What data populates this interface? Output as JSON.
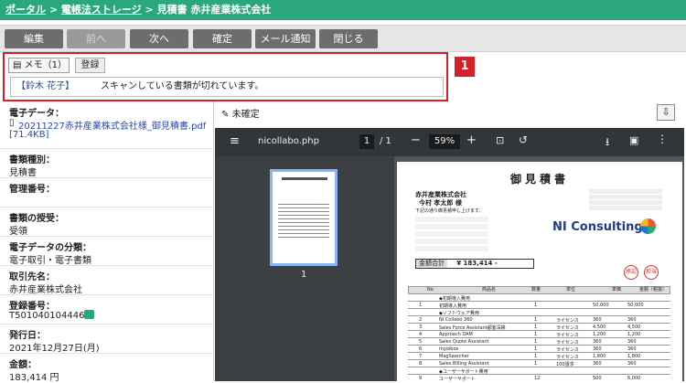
{
  "breadcrumb": {
    "portal": "ポータル",
    "sep1": " > ",
    "storage": "電帳法ストレージ",
    "sep2": " > ",
    "current": "見積書 赤井産業株式会社"
  },
  "toolbar": {
    "edit": "編集",
    "prev": "前へ",
    "next": "次へ",
    "confirm": "確定",
    "mail": "メール通知",
    "close": "閉じる"
  },
  "memo": {
    "tab_label": "メモ（1）",
    "register": "登録",
    "user": "【鈴木 花子】",
    "text": "スキャンしている書類が切れています。",
    "badge": "1"
  },
  "fields": [
    {
      "label": "電子データ：",
      "value": "20211227赤井産業株式会社様_御見積書.pdf",
      "extra": "[71.4KB]"
    },
    {
      "label": "書類種別：",
      "value": "見積書"
    },
    {
      "label": "管理番号：",
      "value": ""
    },
    {
      "label": "書類の授受：",
      "value": "受領"
    },
    {
      "label": "電子データの分類：",
      "value": "電子取引・電子書類"
    },
    {
      "label": "取引先名：",
      "value": "赤井産業株式会社"
    },
    {
      "label": "登録番号：",
      "value": "T5010401044466"
    },
    {
      "label": "発行日：",
      "value": "2021年12月27日(月)"
    },
    {
      "label": "金額：",
      "value": "183,414 円"
    }
  ],
  "viewer": {
    "status": "未確定",
    "file": "nicollabo.php",
    "page": "1",
    "pages": "/ 1",
    "zoom": "59%",
    "thumb_label": "1"
  },
  "doc": {
    "title": "御見積書",
    "company": "赤井産業株式会社",
    "person": "今村 孝太郎 様",
    "intro": "下記の通り御見積申し上げます。",
    "logo": "NI Consulting",
    "total_label": "金額合計",
    "total_value": "¥ 183,414 -",
    "stamp1": "承認",
    "stamp2": "担当"
  },
  "table": {
    "headers": [
      "No",
      "商品名",
      "数量",
      "単位",
      "単価",
      "金額（税抜）"
    ],
    "rows": [
      [
        "",
        "◆初期導入費用",
        "",
        "",
        "",
        ""
      ],
      [
        "1",
        "初期導入費用",
        "1",
        "",
        "50,000",
        "50,000"
      ],
      [
        "",
        "◆ソフトウェア費用",
        "",
        "",
        "",
        ""
      ],
      [
        "2",
        "NI Collabo 360",
        "1",
        "ライセンス",
        "360",
        "360"
      ],
      [
        "3",
        "Sales Force Assistant顧客深耕",
        "1",
        "ライセンス",
        "4,500",
        "4,500"
      ],
      [
        "4",
        "Approach DAM",
        "1",
        "ライセンス",
        "1,200",
        "1,200"
      ],
      [
        "5",
        "Sales Quote Assistant",
        "1",
        "ライセンス",
        "360",
        "360"
      ],
      [
        "6",
        "myoibox",
        "1",
        "ライセンス",
        "360",
        "360"
      ],
      [
        "7",
        "MagSearcher",
        "1",
        "ライセンス",
        "1,800",
        "1,800"
      ],
      [
        "8",
        "Sales Billing Assistant",
        "1",
        "100請求",
        "360",
        "360"
      ],
      [
        "",
        "◆ユーザーサポート費用",
        "",
        "",
        "",
        ""
      ],
      [
        "9",
        "ユーザーサポート",
        "12",
        "",
        "500",
        "6,000"
      ]
    ]
  },
  "colors": {
    "header_green": "#2aa77c",
    "memo_red": "#d4202a",
    "link_blue": "#2a4aa8"
  }
}
